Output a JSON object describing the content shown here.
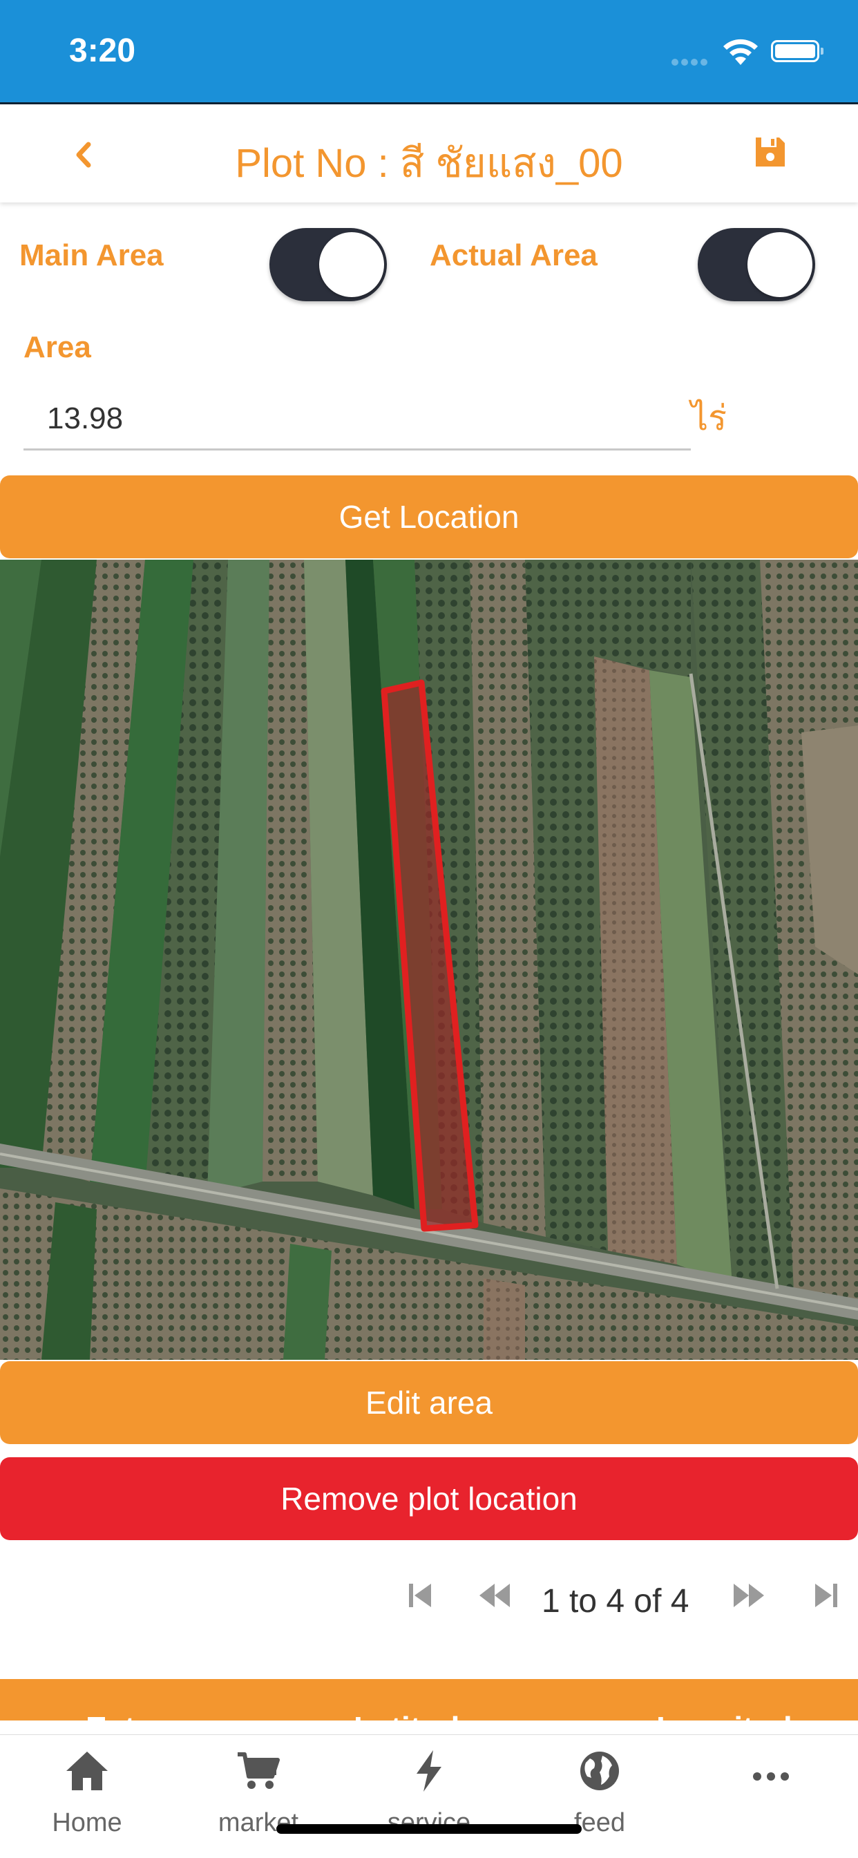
{
  "status_bar": {
    "time": "3:20"
  },
  "header": {
    "title": "Plot No : สี ชัยแสง_00"
  },
  "toggles": {
    "main_area": {
      "label": "Main Area",
      "on": true
    },
    "actual_area": {
      "label": "Actual Area",
      "on": true
    }
  },
  "area": {
    "label": "Area",
    "value": "13.98",
    "unit": "ไร่"
  },
  "buttons": {
    "get_location": "Get Location",
    "edit_area": "Edit area",
    "remove_location": "Remove plot location"
  },
  "pagination": {
    "text": "1 to 4 of 4"
  },
  "table": {
    "columns": [
      "Ext",
      "Latitude",
      "Longitude"
    ]
  },
  "tabs": [
    {
      "label": "Home",
      "icon": "home-icon"
    },
    {
      "label": "market",
      "icon": "cart-icon"
    },
    {
      "label": "service",
      "icon": "bolt-icon"
    },
    {
      "label": "feed",
      "icon": "globe-icon"
    },
    {
      "label": "",
      "icon": "more-icon"
    }
  ],
  "colors": {
    "status_bar": "#1b90d8",
    "accent": "#f3962f",
    "danger": "#e8232d",
    "toggle_on": "#2b2f3b",
    "plot_outline": "#e02020"
  }
}
